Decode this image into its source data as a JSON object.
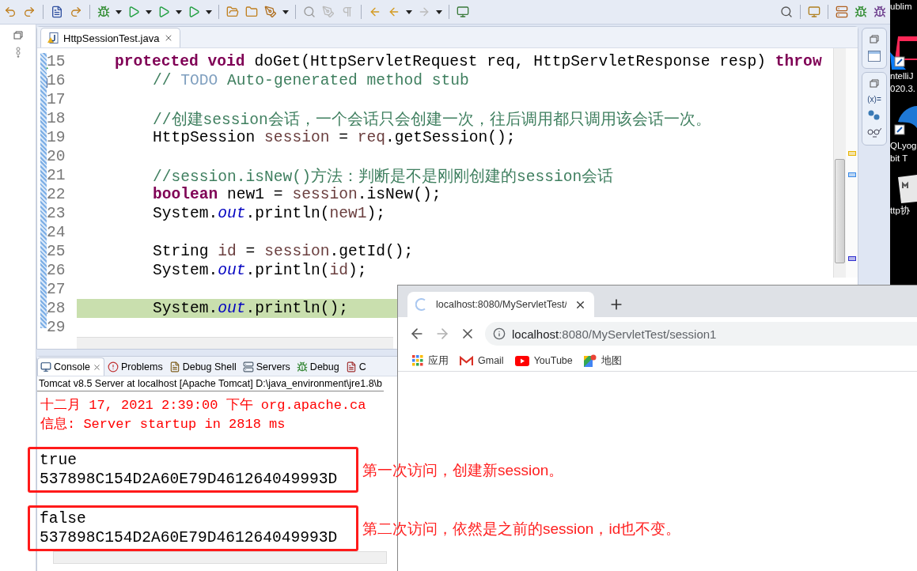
{
  "editor": {
    "tabs": [
      {
        "label": "HttpSessionTest.java",
        "selected": true
      }
    ],
    "lines": [
      {
        "number": "15",
        "indented": false,
        "marker": {
          "kind": "override"
        },
        "highlighted": false,
        "segments": [
          {
            "kind": "keyword",
            "text": "protected void"
          },
          {
            "kind": "plain",
            "text": " doGet(HttpServletRequest req, HttpServletResponse resp) "
          },
          {
            "kind": "keyword",
            "text": "throw"
          }
        ]
      },
      {
        "number": "16",
        "indented": true,
        "marker": {
          "kind": "task"
        },
        "highlighted": false,
        "segments": [
          {
            "kind": "comment",
            "text": "// "
          },
          {
            "kind": "todo",
            "text": "TODO"
          },
          {
            "kind": "comment",
            "text": " Auto-generated method stub"
          }
        ]
      },
      {
        "number": "17",
        "highlighted": false
      },
      {
        "number": "18",
        "indented": true,
        "highlighted": false,
        "segments": [
          {
            "kind": "comment",
            "text": "//创建session会话，一个会话只会创建一次，往后调用都只调用该会话一次。"
          }
        ]
      },
      {
        "number": "19",
        "indented": true,
        "highlighted": false,
        "segments": [
          {
            "kind": "plain",
            "text": "HttpSession "
          },
          {
            "kind": "variable",
            "text": "session"
          },
          {
            "kind": "plain",
            "text": " = "
          },
          {
            "kind": "variable",
            "text": "req"
          },
          {
            "kind": "plain",
            "text": ".getSession();"
          }
        ]
      },
      {
        "number": "20",
        "highlighted": false
      },
      {
        "number": "21",
        "indented": true,
        "highlighted": false,
        "segments": [
          {
            "kind": "comment",
            "text": "//session.isNew()方法：判断是不是刚刚创建的session会话"
          }
        ]
      },
      {
        "number": "22",
        "indented": true,
        "highlighted": false,
        "segments": [
          {
            "kind": "keyword",
            "text": "boolean"
          },
          {
            "kind": "plain",
            "text": " new1 = "
          },
          {
            "kind": "variable",
            "text": "session"
          },
          {
            "kind": "plain",
            "text": ".isNew();"
          }
        ]
      },
      {
        "number": "23",
        "indented": true,
        "highlighted": false,
        "segments": [
          {
            "kind": "plain",
            "text": "System."
          },
          {
            "kind": "field",
            "text": "out"
          },
          {
            "kind": "plain",
            "text": ".println("
          },
          {
            "kind": "variable",
            "text": "new1"
          },
          {
            "kind": "plain",
            "text": ");"
          }
        ]
      },
      {
        "number": "24",
        "highlighted": false
      },
      {
        "number": "25",
        "indented": true,
        "highlighted": false,
        "segments": [
          {
            "kind": "plain",
            "text": "String "
          },
          {
            "kind": "variable",
            "text": "id"
          },
          {
            "kind": "plain",
            "text": " = "
          },
          {
            "kind": "variable",
            "text": "session"
          },
          {
            "kind": "plain",
            "text": ".getId();"
          }
        ]
      },
      {
        "number": "26",
        "indented": true,
        "highlighted": false,
        "segments": [
          {
            "kind": "plain",
            "text": "System."
          },
          {
            "kind": "field",
            "text": "out"
          },
          {
            "kind": "plain",
            "text": ".println("
          },
          {
            "kind": "variable",
            "text": "id"
          },
          {
            "kind": "plain",
            "text": ");"
          }
        ]
      },
      {
        "number": "27",
        "highlighted": false
      },
      {
        "number": "28",
        "indented": true,
        "marker": {
          "kind": "debug"
        },
        "highlighted": true,
        "segments": [
          {
            "kind": "plain",
            "text": "System."
          },
          {
            "kind": "field",
            "text": "out"
          },
          {
            "kind": "plain",
            "text": ".println();"
          }
        ]
      },
      {
        "number": "29",
        "highlighted": false
      }
    ]
  },
  "console": {
    "tabs": [
      {
        "label": "Console",
        "kind": "console",
        "selected": true
      },
      {
        "label": "Problems",
        "kind": "problems",
        "selected": false
      },
      {
        "label": "Debug Shell",
        "kind": "shell",
        "selected": false
      },
      {
        "label": "Servers",
        "kind": "servers",
        "selected": false
      },
      {
        "label": "Debug",
        "kind": "debug",
        "selected": false
      },
      {
        "label": "C",
        "kind": "coverage",
        "selected": false
      }
    ],
    "process": "Tomcat v8.5 Server at localhost [Apache Tomcat] D:\\java_environment\\jre1.8\\b",
    "groups": [
      {
        "framed": false,
        "lines": [
          {
            "kind": "stderr",
            "text": "十二月 17, 2021 2:39:00 下午 org.apache.ca"
          },
          {
            "kind": "stderr",
            "text": "信息: Server startup in 2818 ms"
          }
        ]
      },
      {
        "framed": true,
        "note": "第一次访问，创建新session。",
        "lines": [
          {
            "kind": "stdout",
            "text": "true"
          },
          {
            "kind": "stdout",
            "text": "537898C154D2A60E79D461264049993D"
          }
        ]
      },
      {
        "framed": true,
        "note": "第二次访问，依然是之前的session，id也不变。",
        "lines": [
          {
            "kind": "stdout",
            "text": "false"
          },
          {
            "kind": "stdout",
            "text": "537898C154D2A60E79D461264049993D"
          }
        ]
      }
    ]
  },
  "right_panel": {
    "variables_label": "(x)="
  },
  "browser": {
    "tabs": [
      {
        "title": "localhost:8080/MyServletTest/",
        "loading": true
      }
    ],
    "nav": [
      {
        "kind": "back",
        "disabled": false
      },
      {
        "kind": "forward",
        "disabled": true
      },
      {
        "kind": "stop",
        "disabled": false
      }
    ],
    "address": {
      "host": "localhost",
      "rest": ":8080/MyServletTest/session1"
    },
    "bookmarks": [
      {
        "kind": "apps",
        "label": "应用"
      },
      {
        "kind": "gmail",
        "label": "Gmail"
      },
      {
        "kind": "youtube",
        "label": "YouTube"
      },
      {
        "kind": "maps",
        "label": "地图"
      }
    ]
  },
  "desktop": {
    "icons": [
      {
        "kind": "sublime",
        "lines": [
          "ublim"
        ]
      },
      {
        "kind": "intellij",
        "lines": [
          "ntelliJ",
          "020.3."
        ]
      },
      {
        "kind": "sqlyog",
        "lines": [
          "QLyog",
          "bit T"
        ]
      },
      {
        "kind": "markdown",
        "lines": [
          "ttp协"
        ]
      }
    ]
  }
}
